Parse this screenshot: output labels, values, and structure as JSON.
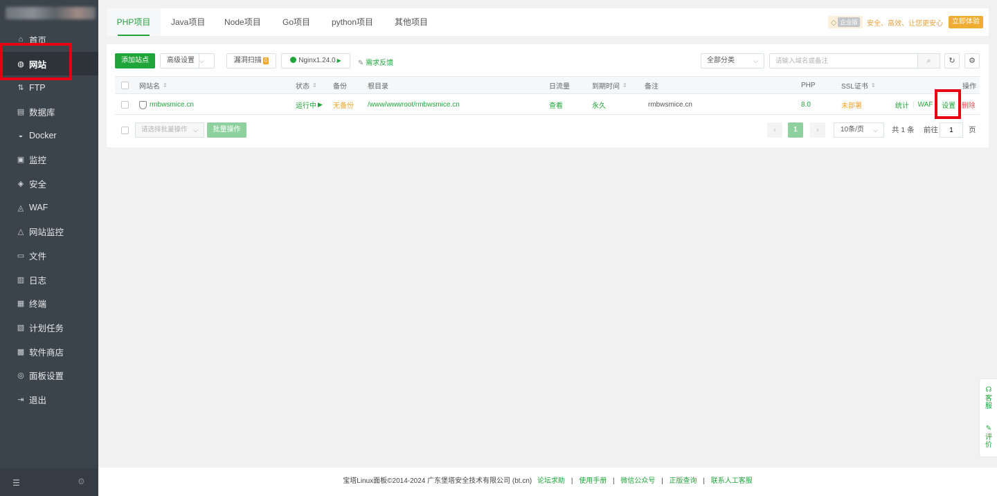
{
  "sidebar": {
    "items": [
      {
        "label": "首页",
        "icon": "home-icon",
        "glyph": "⌂"
      },
      {
        "label": "网站",
        "icon": "globe-icon",
        "glyph": "◍"
      },
      {
        "label": "FTP",
        "icon": "ftp-icon",
        "glyph": "⇅"
      },
      {
        "label": "数据库",
        "icon": "database-icon",
        "glyph": "▤"
      },
      {
        "label": "Docker",
        "icon": "docker-icon",
        "glyph": "◒"
      },
      {
        "label": "监控",
        "icon": "monitor-icon",
        "glyph": "▣"
      },
      {
        "label": "安全",
        "icon": "shield-icon",
        "glyph": "◈"
      },
      {
        "label": "WAF",
        "icon": "waf-icon",
        "glyph": "◬"
      },
      {
        "label": "网站监控",
        "icon": "site-monitor-icon",
        "glyph": "△"
      },
      {
        "label": "文件",
        "icon": "folder-icon",
        "glyph": "▭"
      },
      {
        "label": "日志",
        "icon": "log-icon",
        "glyph": "▥"
      },
      {
        "label": "终端",
        "icon": "terminal-icon",
        "glyph": "▦"
      },
      {
        "label": "计划任务",
        "icon": "task-icon",
        "glyph": "▧"
      },
      {
        "label": "软件商店",
        "icon": "store-icon",
        "glyph": "▩"
      },
      {
        "label": "面板设置",
        "icon": "settings-icon",
        "glyph": "◎"
      },
      {
        "label": "退出",
        "icon": "logout-icon",
        "glyph": "⇥"
      }
    ],
    "active_index": 1
  },
  "tabs": [
    "PHP项目",
    "Java项目",
    "Node项目",
    "Go项目",
    "python项目",
    "其他项目"
  ],
  "enterprise": {
    "tag": "企业版",
    "slogan": "安全、高效、让您更安心",
    "button": "立即体验"
  },
  "toolbar": {
    "add_site": "添加站点",
    "advanced": "高级设置",
    "vuln_scan": "漏洞扫描",
    "vuln_count": "0",
    "nginx": "Nginx1.24.0",
    "feedback": "需求反馈",
    "category": "全部分类",
    "search_placeholder": "请输入域名或备注"
  },
  "table": {
    "headers": {
      "name": "网站名",
      "status": "状态",
      "backup": "备份",
      "root": "根目录",
      "traffic": "日流量",
      "expire": "到期时间",
      "remark": "备注",
      "php": "PHP",
      "ssl": "SSL证书",
      "actions": "操作"
    },
    "rows": [
      {
        "name": "rmbwsmice.cn",
        "status": "运行中",
        "backup": "无备份",
        "root": "/www/wwwroot/rmbwsmice.cn",
        "traffic": "查看",
        "expire": "永久",
        "remark": "rmbwsmice.cn",
        "php": "8.0",
        "ssl": "未部署",
        "act_stats": "统计",
        "act_waf": "WAF",
        "act_settings": "设置",
        "act_delete": "删除"
      }
    ]
  },
  "batch": {
    "select_placeholder": "请选择批量操作",
    "button": "批量操作"
  },
  "pager": {
    "prev": "‹",
    "current": "1",
    "next": "›",
    "per_page": "10条/页",
    "total": "共 1 条",
    "goto_label": "前往",
    "goto_value": "1",
    "page_suffix": "页"
  },
  "footer": {
    "copyright": "宝塔Linux面板©2014-2024 广东堡塔安全技术有限公司 (bt.cn)",
    "links": [
      "论坛求助",
      "使用手册",
      "微信公众号",
      "正版查询",
      "联系人工客服"
    ]
  },
  "float": {
    "service": "客服",
    "review": "评价"
  }
}
